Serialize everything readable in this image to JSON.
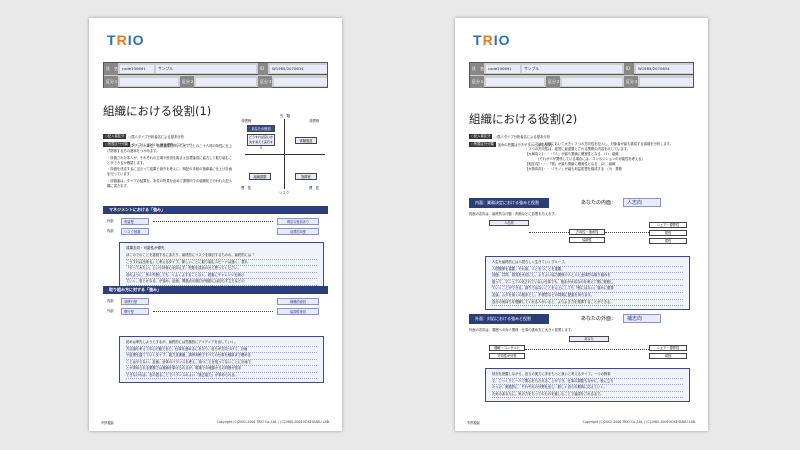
{
  "footer": {
    "left": "不許複製",
    "right": "Copyright (C)2002-2006 TRIO Co.,Ltd. / (C)1985-2006 KOSEIGAKU LAB."
  },
  "logo": "TRIO",
  "info": {
    "name_label": "氏　名",
    "id_value": "code100691",
    "name_value": "サンプル",
    "id_label": "ID",
    "id_code": "W1985/2070634",
    "section1_label": "区分１",
    "section2_label": "区分２",
    "section3_label": "区分３"
  },
  "page1": {
    "title": "組織における役割(1)",
    "meta": [
      {
        "tag": "○記入者区分",
        "text": "○属人タイプ分析者名による基本分析"
      },
      {
        "tag": "○所属区分分類",
        "text": "タイプ(ムヨ2018) 新管理職(パスワード)"
      }
    ],
    "bullets": [
      "・ここでは、プロジェクト単位、目標達成において大てことのこ十人材の特性に仕上げ関係する方の基本をつかみます。",
      "・評価された本人が、それぞれの立場や役割を踏まえ目標達成に協力して取り組むことができるか確認します。",
      "・評価を決定するに当たって結果と働きを考えに、明記の手段の指導者に仕上げ計画を行っています。",
      "・評価者は、タイプの結果を、本件の所見を含めて業務内での組織化で行われた記入欄に書きます。"
    ],
    "quad": {
      "top": "先　駆",
      "bottom": "リスク",
      "left_top": "非慣例",
      "right_top": "非慣例",
      "left_bottom": "慣　性",
      "right_bottom": "慣　性",
      "role_title": "あなたの役割",
      "role_text": "どうすれば良いか先を考えて実行する",
      "box_tl": "開発型",
      "box_tr": "体験推進",
      "box_bl": "組織調整",
      "box_br": "指揮官"
    },
    "section1": {
      "band": "マネジメントにおける「強み」",
      "row1_key": "外部",
      "row1_value": "有望型",
      "row1_right": "得意な役割あり",
      "row2_key": "内部",
      "row2_value": "リスク回避",
      "row2_right": "目標志向型",
      "box_head": "成果志向・可能性が優先",
      "box_lines": [
        "ほこのでのことを重視するにあたり、最終的にリスクを検討するものの、最終的には「",
        "こうすれば出来る」と考えるタイプ。新しいことに取り組むスピードは速く、表れ",
        "「やってみたい」という好奇心を抑えず、失敗を成功の元と思ってください。",
        "決のように、多少失敗しても、くよくよすることなく、着実にチャレンジを続け",
        "ていく、前とかなる、が強み。反面、問題点の検討が細部には回らず立ちなどの"
      ]
    },
    "section2": {
      "band": "取り組み方に対する「強み」",
      "row1_key": "内部",
      "row1_value": "非慣行型",
      "row1_right": "戦略的役割",
      "row2_key": "外部",
      "row2_value": "慣行型",
      "row2_right": "協調性役割",
      "box_lines": [
        "初めは率先しようとするが、最終的には究極的にアイディアを出していく。",
        "方法論を考えて中心行動であり、仕事を進めるにあたり、自らが方向づけて、計画",
        "や目標を建てていくタイプ。能力支援度、調停判断ですべての仕事を細部まで確める",
        "ことはやらない。反面、全体のバランスを考え、持つことを知ってないことに計画で",
        "とが求められる業務では実績を挙げられるが、現場での細部からの判断が苦手",
        "できなければ、志の語ることでバランスのよい「適正能力」が求められる。"
      ]
    }
  },
  "page2": {
    "title": "組織における役割(2)",
    "meta": [
      {
        "tag": "○記入者区分",
        "text": "○属人タイプ分析者名による基本分析"
      },
      {
        "tag": "○所属区分分類",
        "text": "強みの把握は行きやすいとは限らない"
      }
    ],
    "bullets": [
      "・ここでは、組織において大きく３つの方向性を記入し、対象者が最も構成する領域を分析します。",
      "・３つの方向性は、経営に最重要とされる業務の内容を示しています。",
      "【大局向２】・・・「人」が最も業績に確実性となる　(1)　組織",
      "　　　　(それが人が関係している場合には、コンポジションの可能性を考える)",
      "【相互向】・・・「物」が最も業績に確実性となる　(2)　組織",
      "【大物向向】・・・「モノ」が最も利益影響を構成する　(3)　業務"
    ],
    "sectionA": {
      "band": "内面：業務決定における強みと役割",
      "key": "あなたの内面：",
      "value": "人志向",
      "caption": "内面の志向は、最終的な行動・判断などに影響を与えます。",
      "flow_left": "人志向",
      "flow_mid1": "方向性・指導性",
      "flow_mid2": "協調性",
      "flow_r1": "シェア・優秀性",
      "flow_r2": "成長",
      "flow_r3": "成長",
      "box_lines": [
        "人生を最終的には人間らしく生きていくグループ。",
        "人間関係を重要。それ故、人とをつことを重要。",
        "評価、共同、感覚を大切にし、よりよい協力関係や人と人と全体的な取り組みを",
        "誰って、マニュアル化されていない仕事でも、相手が大切なのを考えて業に実践し",
        "ていくことができる。誤りではないことを以上にしても「他にはない」強みに優秀",
        "友達、ムダを省くの相手とし、不得意などの同期に配慮を持ちます。",
        "自分の気持ちを理解してくれる人がいると、よりよき力を発揮することができる。"
      ]
    },
    "sectionB": {
      "band": "外面：対応における強みと役割",
      "key": "あなたの外面：",
      "value": "補志向",
      "caption": "外面の志向は、周囲への対人関係・仕事の進め方に大きく影響します。",
      "flow_left": "あなた",
      "flow_l1": "機敏・コンサルト",
      "flow_l2": "方向性が分析",
      "flow_r1": "シェア・優秀性",
      "flow_r2": "成長",
      "box_lines": [
        "状況を把握しながら、自らの実力に手をもっと良いと考えるタイプ。一つの物事",
        "で、じっくりと一人で関心をもたれることができ、仕事の調整もなかに、役に立ち",
        "たっけ、実践的に、それぞれの分野を出し、新しく自らの期待に応えていく。",
        "ためのあなたに、気の力をもってのものを楽しむことで達成をされるまで。"
      ]
    }
  }
}
